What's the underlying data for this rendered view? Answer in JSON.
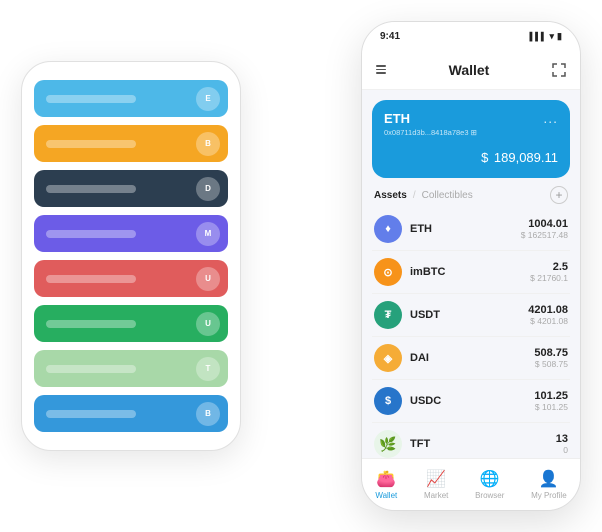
{
  "scene": {
    "back_phone": {
      "cards": [
        {
          "id": "card-blue",
          "color": "#4db8e8",
          "icon_char": ""
        },
        {
          "id": "card-orange",
          "color": "#f5a623",
          "icon_char": ""
        },
        {
          "id": "card-dark",
          "color": "#2c3e50",
          "icon_char": ""
        },
        {
          "id": "card-purple",
          "color": "#6c5ce7",
          "icon_char": ""
        },
        {
          "id": "card-red",
          "color": "#e05c5c",
          "icon_char": ""
        },
        {
          "id": "card-green",
          "color": "#27ae60",
          "icon_char": ""
        },
        {
          "id": "card-light-green",
          "color": "#a8d8a8",
          "icon_char": ""
        },
        {
          "id": "card-bright-blue",
          "color": "#3498db",
          "icon_char": ""
        }
      ]
    },
    "front_phone": {
      "status_bar": {
        "time": "9:41",
        "signal": "▌▌▌",
        "wifi": "WiFi",
        "battery": "🔋"
      },
      "header": {
        "menu_icon": "≡",
        "title": "Wallet",
        "expand_icon": "⛶"
      },
      "eth_card": {
        "title": "ETH",
        "dots": "...",
        "address": "0x08711d3b...8418a78e3 ⊞",
        "currency_symbol": "$",
        "balance": "189,089.11"
      },
      "assets_section": {
        "tab_active": "Assets",
        "divider": "/",
        "tab_inactive": "Collectibles",
        "add_icon": "+"
      },
      "asset_list": [
        {
          "id": "eth",
          "name": "ETH",
          "icon_char": "♦",
          "icon_bg": "#627eea",
          "amount": "1004.01",
          "usd": "$ 162517.48"
        },
        {
          "id": "imbtc",
          "name": "imBTC",
          "icon_char": "⊙",
          "icon_bg": "#f7931a",
          "amount": "2.5",
          "usd": "$ 21760.1"
        },
        {
          "id": "usdt",
          "name": "USDT",
          "icon_char": "₮",
          "icon_bg": "#26a17b",
          "amount": "4201.08",
          "usd": "$ 4201.08"
        },
        {
          "id": "dai",
          "name": "DAI",
          "icon_char": "◈",
          "icon_bg": "#f5ac37",
          "amount": "508.75",
          "usd": "$ 508.75"
        },
        {
          "id": "usdc",
          "name": "USDC",
          "icon_char": "$",
          "icon_bg": "#2775ca",
          "amount": "101.25",
          "usd": "$ 101.25"
        },
        {
          "id": "tft",
          "name": "TFT",
          "icon_char": "🌿",
          "icon_bg": "#e8f5e9",
          "amount": "13",
          "usd": "0"
        }
      ],
      "bottom_nav": [
        {
          "id": "wallet",
          "label": "Wallet",
          "icon": "👛",
          "active": true
        },
        {
          "id": "market",
          "label": "Market",
          "icon": "📈",
          "active": false
        },
        {
          "id": "browser",
          "label": "Browser",
          "icon": "🌐",
          "active": false
        },
        {
          "id": "profile",
          "label": "My Profile",
          "icon": "👤",
          "active": false
        }
      ]
    }
  }
}
